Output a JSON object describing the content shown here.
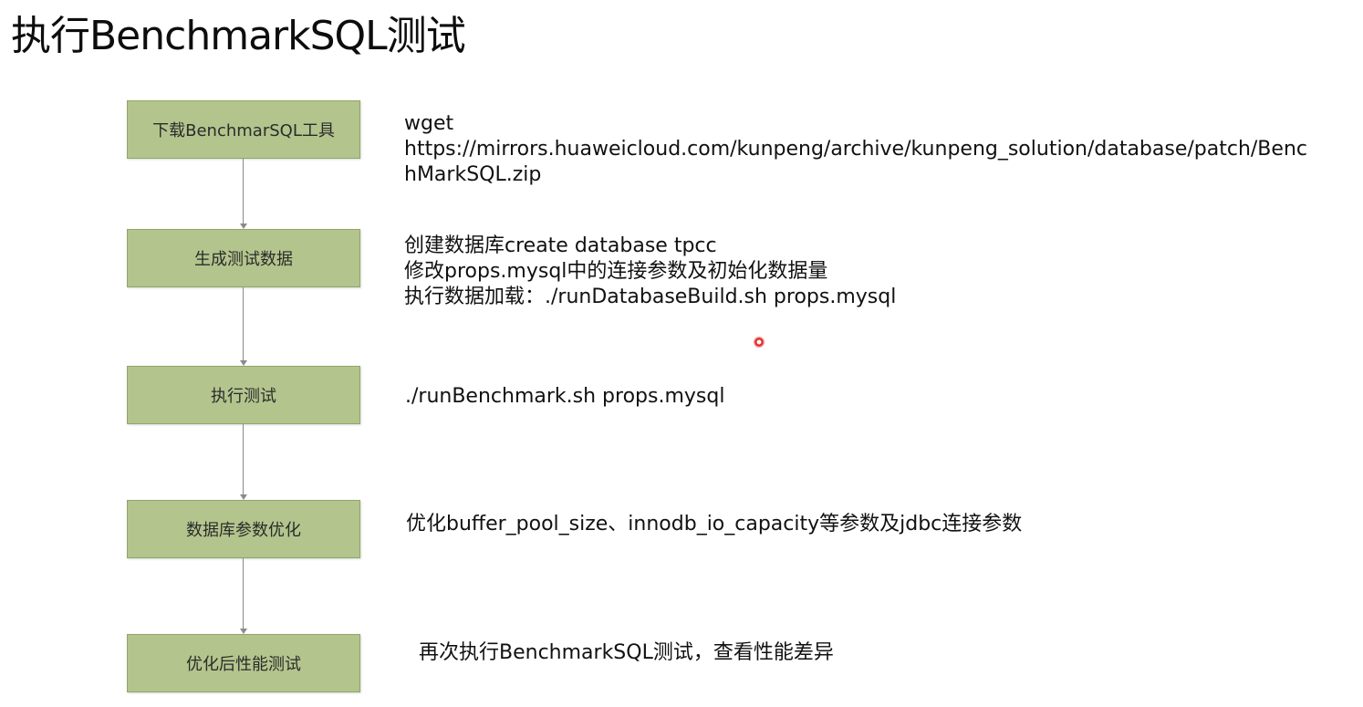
{
  "title": "执行BenchmarkSQL测试",
  "steps": [
    {
      "label": "下载BenchmarSQL工具",
      "lines": [
        "wget",
        "https://mirrors.huaweicloud.com/kunpeng/archive/kunpeng_solution/database/patch/Benc",
        "hMarkSQL.zip"
      ]
    },
    {
      "label": "生成测试数据",
      "lines": [
        "创建数据库create database tpcc",
        "修改props.mysql中的连接参数及初始化数据量",
        "执行数据加载：./runDatabaseBuild.sh props.mysql"
      ]
    },
    {
      "label": "执行测试",
      "lines": [
        "./runBenchmark.sh props.mysql"
      ]
    },
    {
      "label": "数据库参数优化",
      "lines": [
        "优化buffer_pool_size、innodb_io_capacity等参数及jdbc连接参数"
      ]
    },
    {
      "label": "优化后性能测试",
      "lines": [
        "再次执行BenchmarkSQL测试，查看性能差异"
      ]
    }
  ],
  "colors": {
    "box_fill": "#b3c58d",
    "box_border": "#8fa66a",
    "connector": "#8a8a8a",
    "pointer": "#e0201c"
  }
}
